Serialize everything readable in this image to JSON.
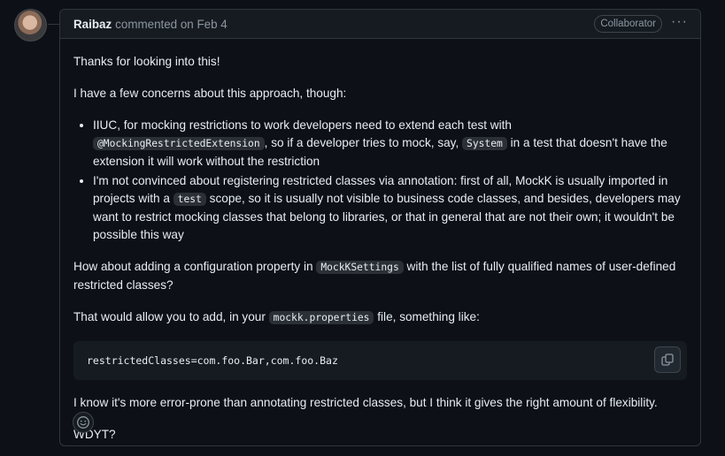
{
  "comment": {
    "author": "Raibaz",
    "action_text": "commented on Feb 4",
    "role_badge": "Collaborator",
    "menu_icon": "kebab-horizontal-icon"
  },
  "body": {
    "p1": "Thanks for looking into this!",
    "p2": "I have a few concerns about this approach, though:",
    "bullet1": {
      "t1": "IIUC, for mocking restrictions to work developers need to extend each test with ",
      "c1": "@MockingRestrictedExtension",
      "t2": ", so if a developer tries to mock, say, ",
      "c2": "System",
      "t3": " in a test that doesn't have the extension it will work without the restriction"
    },
    "bullet2": {
      "t1": "I'm not convinced about registering restricted classes via annotation: first of all, MockK is usually imported in projects with a ",
      "c1": "test",
      "t2": " scope, so it is usually not visible to business code classes, and besides, developers may want to restrict mocking classes that belong to libraries, or that in general that are not their own; it wouldn't be possible this way"
    },
    "p3": {
      "t1": "How about adding a configuration property in ",
      "c1": "MockKSettings",
      "t2": " with the list of fully qualified names of user-defined restricted classes?"
    },
    "p4": {
      "t1": "That would allow you to add, in your ",
      "c1": "mockk.properties",
      "t2": " file, something like:"
    },
    "code_block": "restrictedClasses=com.foo.Bar,com.foo.Baz",
    "p5": "I know it's more error-prone than annotating restricted classes, but I think it gives the right amount of flexibility.",
    "p6": "WDYT?"
  },
  "icons": {
    "copy": "copy-icon",
    "reaction": "smiley-icon"
  }
}
